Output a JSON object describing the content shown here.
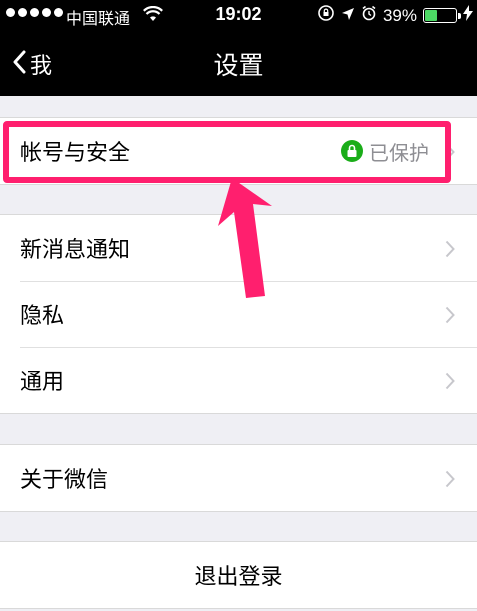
{
  "status_bar": {
    "carrier": "中国联通",
    "time": "19:02",
    "battery_percent": "39%",
    "battery_level": 0.39,
    "signal_dots": 5
  },
  "nav": {
    "back_label": "我",
    "title": "设置"
  },
  "groups": [
    {
      "rows": [
        {
          "label": "帐号与安全",
          "status": "已保护",
          "status_icon": "lock-icon"
        }
      ]
    },
    {
      "rows": [
        {
          "label": "新消息通知"
        },
        {
          "label": "隐私"
        },
        {
          "label": "通用"
        }
      ]
    },
    {
      "rows": [
        {
          "label": "关于微信"
        }
      ]
    }
  ],
  "logout": {
    "label": "退出登录"
  },
  "colors": {
    "highlight": "#ff1f6e",
    "protected_green": "#1aad19",
    "battery_green": "#4cd964"
  }
}
